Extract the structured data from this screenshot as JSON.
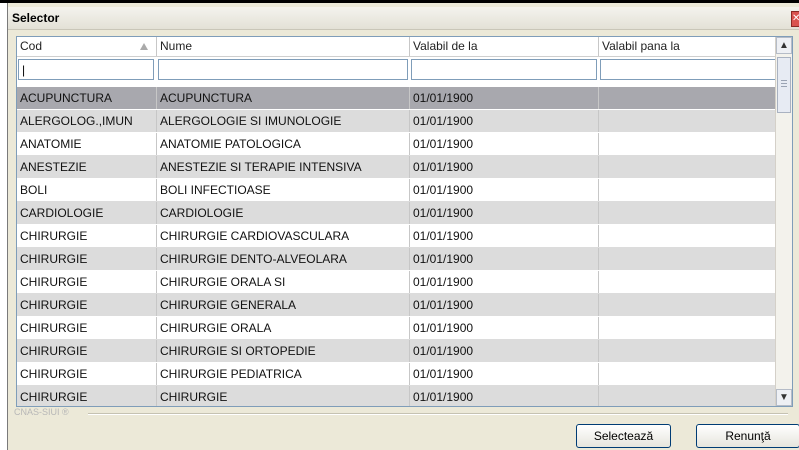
{
  "window": {
    "title": "Selector"
  },
  "grid": {
    "columns": [
      "Cod",
      "Nume",
      "Valabil de la",
      "Valabil pana la"
    ],
    "filters": {
      "cod": "|",
      "nume": "",
      "valabil_de_la": "",
      "valabil_pana_la": ""
    },
    "rows": [
      {
        "cod": "ACUPUNCTURA",
        "nume": "ACUPUNCTURA",
        "de_la": "01/01/1900",
        "pana_la": ""
      },
      {
        "cod": "ALERGOLOG.,IMUN",
        "nume": "ALERGOLOGIE SI IMUNOLOGIE",
        "de_la": "01/01/1900",
        "pana_la": ""
      },
      {
        "cod": "ANATOMIE",
        "nume": "ANATOMIE PATOLOGICA",
        "de_la": "01/01/1900",
        "pana_la": ""
      },
      {
        "cod": "ANESTEZIE",
        "nume": "ANESTEZIE SI TERAPIE INTENSIVA",
        "de_la": "01/01/1900",
        "pana_la": ""
      },
      {
        "cod": "BOLI",
        "nume": "BOLI INFECTIOASE",
        "de_la": "01/01/1900",
        "pana_la": ""
      },
      {
        "cod": "CARDIOLOGIE",
        "nume": "CARDIOLOGIE",
        "de_la": "01/01/1900",
        "pana_la": ""
      },
      {
        "cod": "CHIRURGIE",
        "nume": "CHIRURGIE CARDIOVASCULARA",
        "de_la": "01/01/1900",
        "pana_la": ""
      },
      {
        "cod": "CHIRURGIE",
        "nume": "CHIRURGIE DENTO-ALVEOLARA",
        "de_la": "01/01/1900",
        "pana_la": ""
      },
      {
        "cod": "CHIRURGIE",
        "nume": "CHIRURGIE ORALA SI",
        "de_la": "01/01/1900",
        "pana_la": ""
      },
      {
        "cod": "CHIRURGIE",
        "nume": "CHIRURGIE GENERALA",
        "de_la": "01/01/1900",
        "pana_la": ""
      },
      {
        "cod": "CHIRURGIE",
        "nume": "CHIRURGIE ORALA",
        "de_la": "01/01/1900",
        "pana_la": ""
      },
      {
        "cod": "CHIRURGIE",
        "nume": "CHIRURGIE SI ORTOPEDIE",
        "de_la": "01/01/1900",
        "pana_la": ""
      },
      {
        "cod": "CHIRURGIE",
        "nume": "CHIRURGIE PEDIATRICA",
        "de_la": "01/01/1900",
        "pana_la": ""
      },
      {
        "cod": "CHIRURGIE",
        "nume": "CHIRURGIE",
        "de_la": "01/01/1900",
        "pana_la": ""
      }
    ]
  },
  "footer": {
    "brand": "CNAS-SIUI ®",
    "select_label": "Selectează",
    "cancel_label": "Renunţă"
  },
  "colors": {
    "selected_row": "#a8a8ae",
    "alt_row": "#dcdcdc",
    "dialog_bg": "#ece9d8",
    "border_blue": "#7f9db9"
  }
}
